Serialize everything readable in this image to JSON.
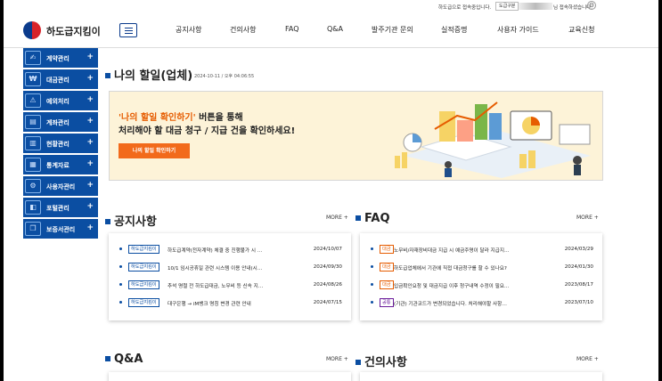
{
  "topbar": {
    "notice": "하도급으로 접속중입니다.",
    "account": "도급구분",
    "login_msg": "님 접속하셨습니다."
  },
  "header": {
    "logo_text": "하도급지킴이",
    "nav": [
      "공지사항",
      "건의사항",
      "FAQ",
      "Q&A",
      "발주기관 문의",
      "실적증명",
      "사용자 가이드",
      "교육신청"
    ]
  },
  "sidebar": [
    {
      "label": "계약관리",
      "icon": "handshake-icon",
      "glyph": "✍"
    },
    {
      "label": "대금관리",
      "icon": "money-icon",
      "glyph": "₩"
    },
    {
      "label": "예외처리",
      "icon": "exception-icon",
      "glyph": "⚠"
    },
    {
      "label": "계좌관리",
      "icon": "account-icon",
      "glyph": "▤"
    },
    {
      "label": "현황관리",
      "icon": "status-icon",
      "glyph": "▥"
    },
    {
      "label": "통계자료",
      "icon": "stats-icon",
      "glyph": "▦"
    },
    {
      "label": "사용자관리",
      "icon": "user-gear-icon",
      "glyph": "⚙"
    },
    {
      "label": "포털관리",
      "icon": "portal-icon",
      "glyph": "◧"
    },
    {
      "label": "보증서관리",
      "icon": "certificate-icon",
      "glyph": "❐"
    }
  ],
  "sidebar_plus": "+",
  "todo": {
    "title": "나의 할일(업체)",
    "timestamp": "2024-10-11 / 오후 04:06:55",
    "banner_hl": "'나의 할일 확인하기'",
    "banner_l1_rest": " 버튼을 통해",
    "banner_l2": "처리해야 할 대금 청구 / 지급 건을 확인하세요!",
    "button": "나의 할일 확인하기"
  },
  "more_label": "MORE +",
  "notice": {
    "title": "공지사항",
    "rows": [
      {
        "tag": "하도급지킴이",
        "text": "하도급계약(전자계약) 체결 중 진행불가 시 …",
        "date": "2024/10/07"
      },
      {
        "tag": "하도급지킴이",
        "text": "10/1 임시공휴일 관련 시스템 이용 안내(시…",
        "date": "2024/09/30"
      },
      {
        "tag": "하도급지킴이",
        "text": "추석 명절 전 하도급대금, 노무비 등 신속 지…",
        "date": "2024/08/26"
      },
      {
        "tag": "하도급지킴이",
        "text": "대구은행 → iM뱅크 명칭 변경 관련 안내",
        "date": "2024/07/15"
      }
    ]
  },
  "faq": {
    "title": "FAQ",
    "rows": [
      {
        "tag": "대금",
        "style": "orange",
        "text": "노무비/자재장비대금 지급 시 예금주명이 달라 지급지…",
        "date": "2024/03/29"
      },
      {
        "tag": "대금",
        "style": "orange",
        "text": "하도급업체에서 기관에 직접 대금청구를 할 수 있나요?",
        "date": "2024/01/30"
      },
      {
        "tag": "대금",
        "style": "orange",
        "text": "입금확인요청 및 대금지급 이후 청구내역 수정이 필요…",
        "date": "2023/08/17"
      },
      {
        "tag": "공통",
        "style": "purple",
        "text": "(기관) 기관코드가 변경되었습니다. 처리해야할 사항…",
        "date": "2023/07/10"
      }
    ]
  },
  "qa": {
    "title": "Q&A"
  },
  "suggest": {
    "title": "건의사항"
  },
  "colors": {
    "primary": "#0b4ea2",
    "accent": "#f26a1b",
    "banner_bg": "#fdf3d8"
  }
}
